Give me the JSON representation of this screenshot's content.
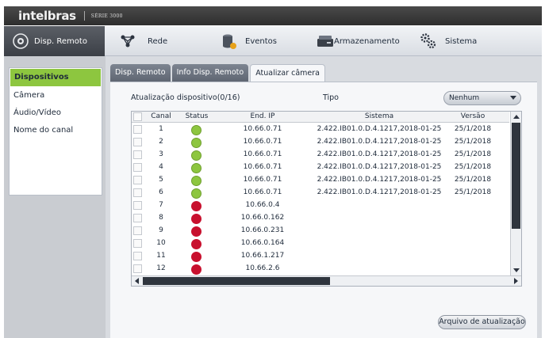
{
  "brand": {
    "name": "intelbras",
    "series": "SÉRIE 3000"
  },
  "menu": [
    {
      "label": "Disp. Remoto",
      "icon": "remote-device-icon"
    },
    {
      "label": "Rede",
      "icon": "network-icon"
    },
    {
      "label": "Eventos",
      "icon": "events-icon"
    },
    {
      "label": "Armazenamento",
      "icon": "storage-icon"
    },
    {
      "label": "Sistema",
      "icon": "system-gears-icon"
    }
  ],
  "sidebar": [
    {
      "label": "Dispositivos"
    },
    {
      "label": "Câmera"
    },
    {
      "label": "Áudio/Vídeo"
    },
    {
      "label": "Nome do canal"
    }
  ],
  "tabs": [
    {
      "label": "Disp. Remoto"
    },
    {
      "label": "Info Disp. Remoto"
    },
    {
      "label": "Atualizar câmera"
    }
  ],
  "update": {
    "info_label": "Atualização dispositivo(0/16)",
    "tipo_label": "Tipo",
    "tipo_value": "Nenhum",
    "button_label": "Arquivo de atualização"
  },
  "table": {
    "headers": [
      "Canal",
      "Status",
      "End. IP",
      "Sistema",
      "Versão"
    ],
    "rows": [
      {
        "canal": "1",
        "status": "online",
        "ip": "10.66.0.71",
        "sistema": "2.422.IB01.0.D.4.1217,2018-01-25",
        "versao": "25/1/2018"
      },
      {
        "canal": "2",
        "status": "online",
        "ip": "10.66.0.71",
        "sistema": "2.422.IB01.0.D.4.1217,2018-01-25",
        "versao": "25/1/2018"
      },
      {
        "canal": "3",
        "status": "online",
        "ip": "10.66.0.71",
        "sistema": "2.422.IB01.0.D.4.1217,2018-01-25",
        "versao": "25/1/2018"
      },
      {
        "canal": "4",
        "status": "online",
        "ip": "10.66.0.71",
        "sistema": "2.422.IB01.0.D.4.1217,2018-01-25",
        "versao": "25/1/2018"
      },
      {
        "canal": "5",
        "status": "online",
        "ip": "10.66.0.71",
        "sistema": "2.422.IB01.0.D.4.1217,2018-01-25",
        "versao": "25/1/2018"
      },
      {
        "canal": "6",
        "status": "online",
        "ip": "10.66.0.71",
        "sistema": "2.422.IB01.0.D.4.1217,2018-01-25",
        "versao": "25/1/2018"
      },
      {
        "canal": "7",
        "status": "offline",
        "ip": "10.66.0.4",
        "sistema": "",
        "versao": ""
      },
      {
        "canal": "8",
        "status": "offline",
        "ip": "10.66.0.162",
        "sistema": "",
        "versao": ""
      },
      {
        "canal": "9",
        "status": "offline",
        "ip": "10.66.0.231",
        "sistema": "",
        "versao": ""
      },
      {
        "canal": "10",
        "status": "offline",
        "ip": "10.66.0.164",
        "sistema": "",
        "versao": ""
      },
      {
        "canal": "11",
        "status": "offline",
        "ip": "10.66.1.217",
        "sistema": "",
        "versao": ""
      },
      {
        "canal": "12",
        "status": "offline",
        "ip": "10.66.2.6",
        "sistema": "",
        "versao": ""
      }
    ]
  },
  "colors": {
    "online": "#8dc63f",
    "offline": "#c8102e",
    "active_sidebar": "#8dc63f"
  }
}
